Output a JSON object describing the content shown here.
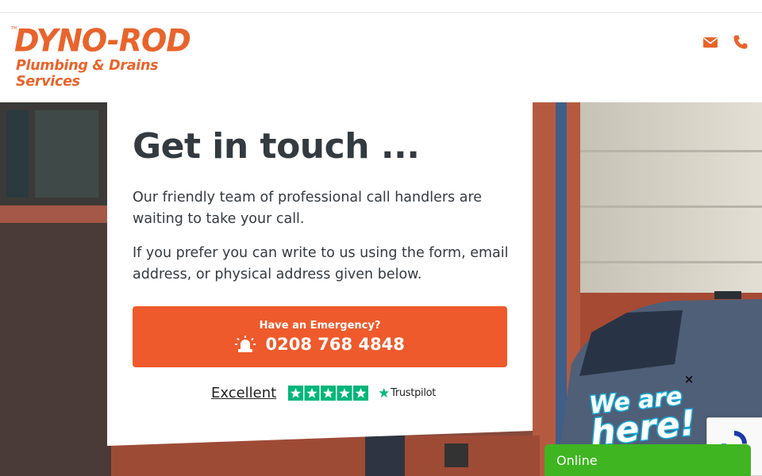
{
  "header": {
    "logo_main": "DYNO-ROD",
    "logo_sub": "Plumbing & Drains Services",
    "logo_tm": "TM",
    "icons": [
      "envelope-icon",
      "phone-icon"
    ],
    "brand_color": "#e8642c"
  },
  "contact": {
    "heading": "Get in touch ...",
    "paragraph_1": "Our friendly team of professional call handlers are waiting to take your call.",
    "paragraph_2": "If you prefer you can write to us using the form, email address, or physical address given below.",
    "emergency_label": "Have an Emergency?",
    "emergency_number": "0208 768 4848",
    "emergency_icon": "siren-icon",
    "cta_color": "#ee5a2c"
  },
  "trustpilot": {
    "rating_text": "Excellent",
    "stars": 5,
    "brand": "Trustpilot",
    "star_color": "#00b67a"
  },
  "chat": {
    "close_label": "×",
    "badge_text": "We are here!",
    "status": "Online",
    "status_color": "#3fb521"
  }
}
